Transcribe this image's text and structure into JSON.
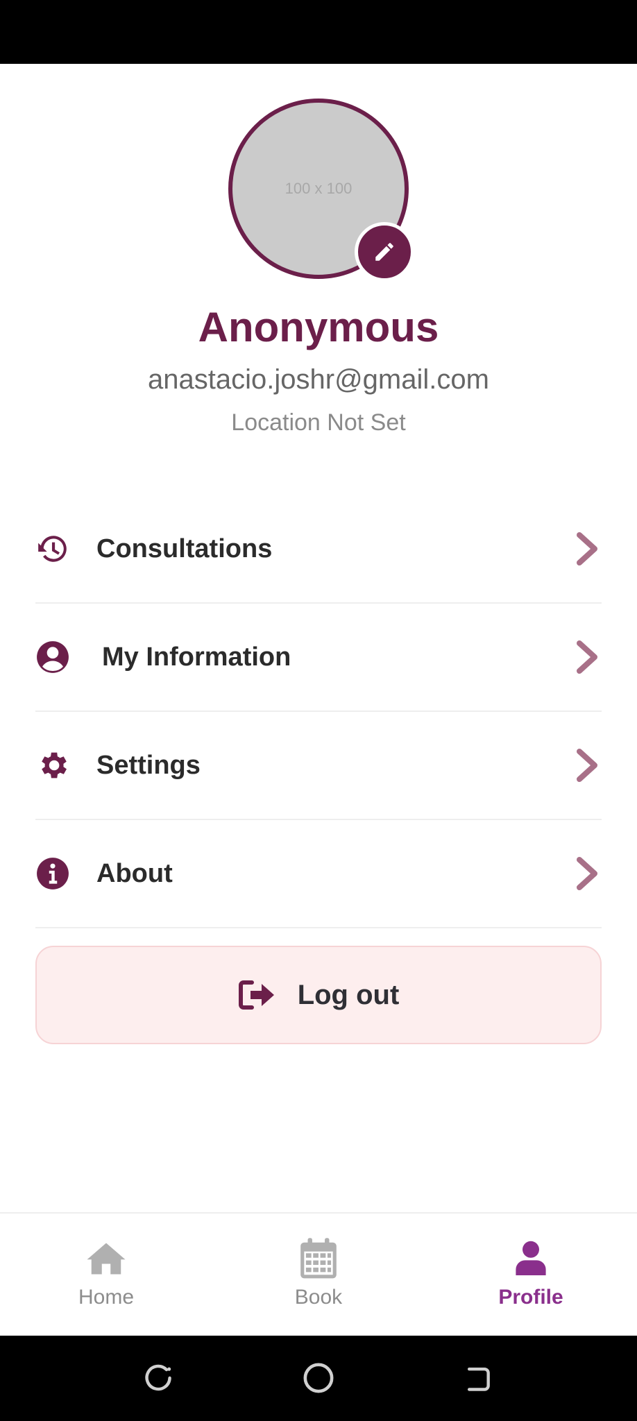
{
  "profile": {
    "avatar_placeholder": "100 x 100",
    "name": "Anonymous",
    "email": "anastacio.joshr@gmail.com",
    "location": "Location Not Set"
  },
  "menu": {
    "items": [
      {
        "label": "Consultations",
        "icon": "history-icon"
      },
      {
        "label": "My Information",
        "icon": "user-circle-icon"
      },
      {
        "label": "Settings",
        "icon": "gear-icon"
      },
      {
        "label": "About",
        "icon": "info-icon"
      }
    ]
  },
  "logout": {
    "label": "Log out",
    "icon": "logout-icon"
  },
  "bottom_nav": {
    "items": [
      {
        "label": "Home",
        "icon": "home-icon",
        "active": false
      },
      {
        "label": "Book",
        "icon": "calendar-icon",
        "active": false
      },
      {
        "label": "Profile",
        "icon": "user-icon",
        "active": true
      }
    ]
  },
  "colors": {
    "primary": "#6b1f4a",
    "accent_active": "#8a2f8c",
    "chevron": "#a87088",
    "logout_bg": "#fdeeee",
    "inactive_icon": "#b0b0b0"
  }
}
